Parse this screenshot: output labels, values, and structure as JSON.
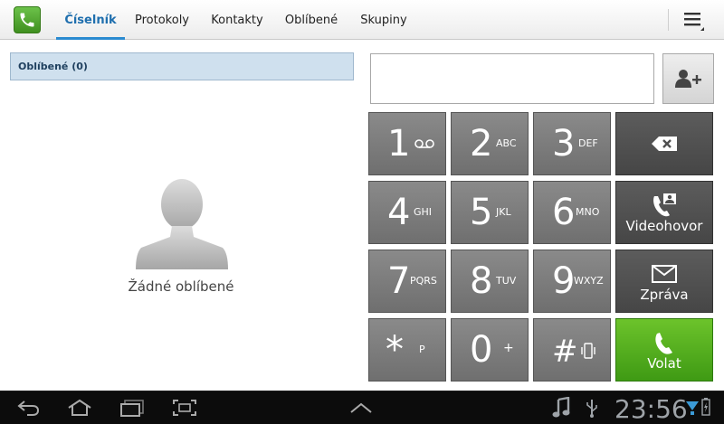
{
  "tabs": [
    {
      "label": "Číselník",
      "active": true
    },
    {
      "label": "Protokoly",
      "active": false
    },
    {
      "label": "Kontakty",
      "active": false
    },
    {
      "label": "Oblíbené",
      "active": false
    },
    {
      "label": "Skupiny",
      "active": false
    }
  ],
  "favorites": {
    "header": "Oblíbené (0)",
    "empty_text": "Žádné oblíbené"
  },
  "number_field": {
    "value": ""
  },
  "keypad": [
    {
      "digit": "1",
      "letters": "",
      "icon": "voicemail-icon"
    },
    {
      "digit": "2",
      "letters": "ABC"
    },
    {
      "digit": "3",
      "letters": "DEF"
    },
    {
      "digit": "4",
      "letters": "GHI"
    },
    {
      "digit": "5",
      "letters": "JKL"
    },
    {
      "digit": "6",
      "letters": "MNO"
    },
    {
      "digit": "7",
      "letters": "PQRS"
    },
    {
      "digit": "8",
      "letters": "TUV"
    },
    {
      "digit": "9",
      "letters": "WXYZ"
    },
    {
      "digit": "*",
      "letters": "P"
    },
    {
      "digit": "0",
      "letters": "+"
    },
    {
      "digit": "#",
      "letters": "",
      "icon": "vibrate-icon"
    }
  ],
  "actions": {
    "videocall": "Videohovor",
    "message": "Zpráva",
    "call": "Volat"
  },
  "system_bar": {
    "time": "23:56"
  },
  "colors": {
    "accent": "#2a8ad0",
    "call_green": "#4caf1f",
    "key_gray": "#7c7c7c",
    "action_dark": "#505050"
  }
}
